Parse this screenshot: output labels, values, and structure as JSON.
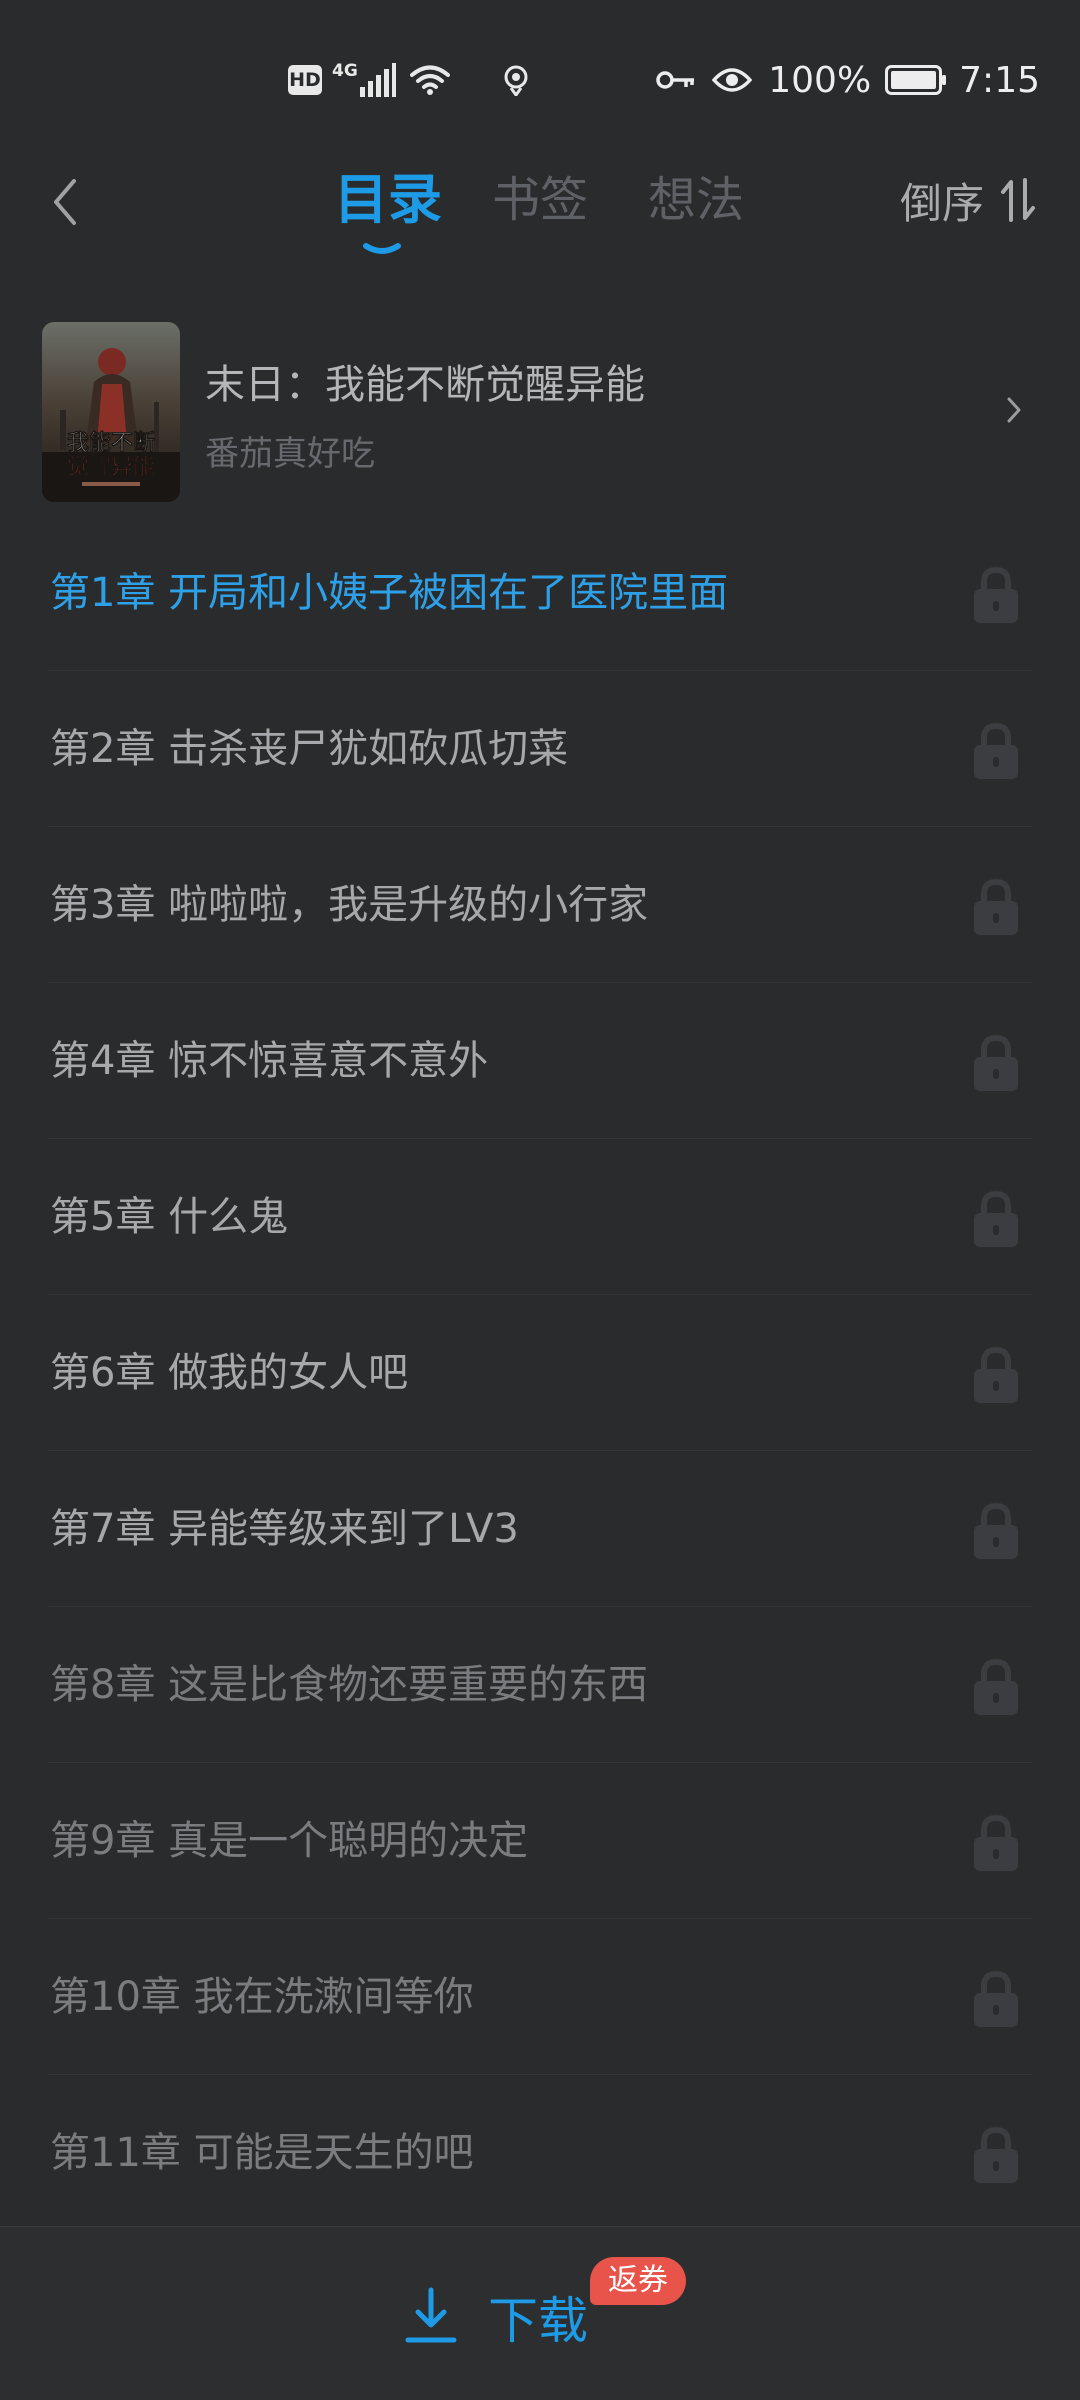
{
  "status_bar": {
    "hd_label": "HD",
    "network_type": "4G",
    "battery_percent": "100%",
    "time": "7:15",
    "icons": [
      "hd-icon",
      "signal-icon",
      "wifi-icon",
      "location-icon",
      "key-icon",
      "eye-icon",
      "battery-icon"
    ]
  },
  "header": {
    "tabs": [
      {
        "label": "目录",
        "active": true
      },
      {
        "label": "书签",
        "active": false
      },
      {
        "label": "想法",
        "active": false
      }
    ],
    "sort_label": "倒序",
    "accent_color": "#1e9be6"
  },
  "book": {
    "title": "末日：我能不断觉醒异能",
    "author": "番茄真好吃",
    "cover_text": "我能不断觉醒异能"
  },
  "chapters": [
    {
      "title": "第1章 开局和小姨子被困在了医院里面",
      "state": "current",
      "locked": true
    },
    {
      "title": "第2章 击杀丧尸犹如砍瓜切菜",
      "state": "normal",
      "locked": true
    },
    {
      "title": "第3章 啦啦啦，我是升级的小行家",
      "state": "normal",
      "locked": true
    },
    {
      "title": "第4章 惊不惊喜意不意外",
      "state": "normal",
      "locked": true
    },
    {
      "title": "第5章 什么鬼",
      "state": "normal",
      "locked": true
    },
    {
      "title": "第6章 做我的女人吧",
      "state": "normal",
      "locked": true
    },
    {
      "title": "第7章 异能等级来到了LV3",
      "state": "normal",
      "locked": true
    },
    {
      "title": "第8章 这是比食物还要重要的东西",
      "state": "dim",
      "locked": true
    },
    {
      "title": "第9章 真是一个聪明的决定",
      "state": "dim",
      "locked": true
    },
    {
      "title": "第10章 我在洗漱间等你",
      "state": "dim",
      "locked": true
    },
    {
      "title": "第11章 可能是天生的吧",
      "state": "dim",
      "locked": true
    }
  ],
  "bottom_bar": {
    "download_label": "下载",
    "coupon_badge": "返券",
    "badge_color": "#e8534a"
  }
}
